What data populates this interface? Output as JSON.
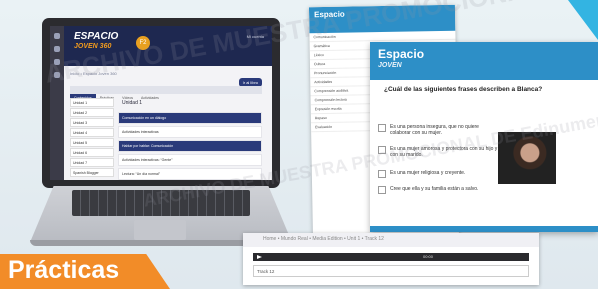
{
  "laptop": {
    "logo_main": "ESPACIO",
    "logo_sub": "JOVEN 360",
    "badge": "F2",
    "user": "Mi cuenta",
    "breadcrumb": "Inicio  •  Espacio Joven 360",
    "button": "Ir al libro",
    "tabs": [
      "Contenidos",
      "Prácticas",
      "Vídeos",
      "Actividades"
    ],
    "units": [
      "Unidad 1",
      "Unidad 2",
      "Unidad 3",
      "Unidad 4",
      "Unidad 5",
      "Unidad 6",
      "Unidad 7",
      "Spanish Blogger"
    ],
    "content_title": "Unidad 1",
    "content_rows": [
      "Comunicación en un diálogo",
      "Actividades interactivas",
      "Hablar por hablar: Comunicación",
      "Actividades interactivas: “Gente”",
      "Lectura: “Un día normal”"
    ]
  },
  "back_panel": {
    "title": "Espacio",
    "items": [
      "Comunicación",
      "Gramática",
      "Léxico",
      "Cultura",
      "Pronunciación",
      "Actividades",
      "Comprensión auditiva",
      "Comprensión lectora",
      "Expresión escrita",
      "Repaso",
      "Evaluación"
    ]
  },
  "quiz": {
    "logo_main": "Espacio",
    "logo_sub": "JOVEN",
    "question": "¿Cuál de las siguientes frases describen a Blanca?",
    "options": [
      "Es una persona insegura, que no quiere colaborar con su mujer.",
      "Es una mujer amorosa y protectora con su hijo y con su marido.",
      "Es una mujer religiosa y creyente.",
      "Cree que ella y su familia están a salvo."
    ]
  },
  "media": {
    "breadcrumb": "Home  •  Mundo Real  •  Media Edition  •  Unit 1  •  Track 12",
    "time": "00:00",
    "track": "Track 12"
  },
  "section_label": "Prácticas",
  "watermark": "ARCHIVO DE MUESTRA PROMOCIONAL DE Edinumen",
  "colors": {
    "accent": "#f28c28",
    "brand_blue": "#2d8fc7",
    "dark_nav": "#1e2850"
  }
}
